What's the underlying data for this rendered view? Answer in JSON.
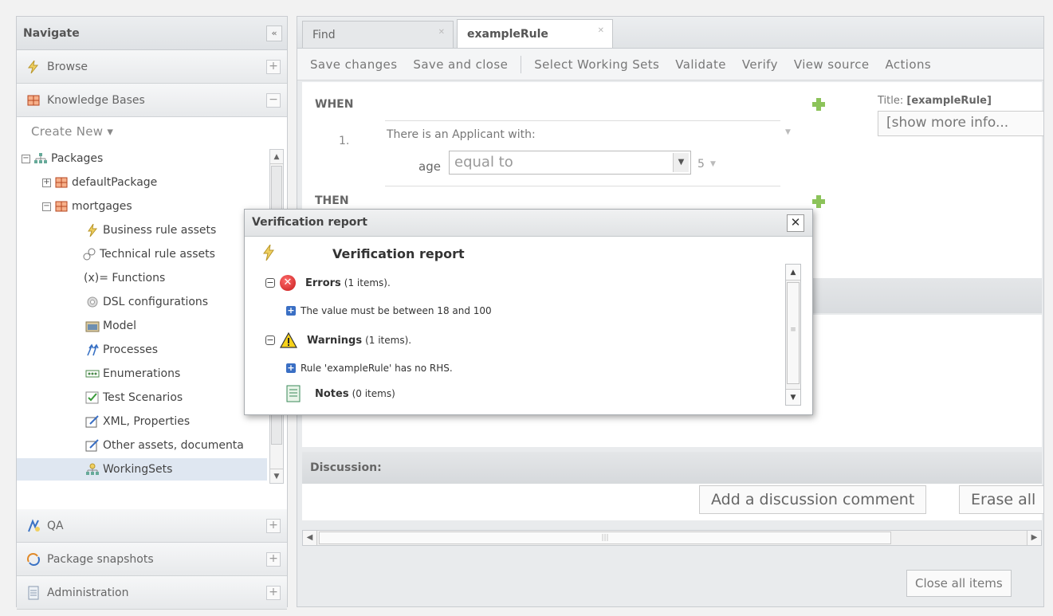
{
  "nav": {
    "title": "Navigate",
    "collapse": "«",
    "sections_top": [
      {
        "label": "Browse",
        "toggle": "+"
      },
      {
        "label": "Knowledge Bases",
        "toggle": "−"
      }
    ],
    "create_new": "Create New ▾",
    "tree": [
      {
        "label": "Packages",
        "expander": "−"
      },
      {
        "label": "defaultPackage",
        "expander": "+"
      },
      {
        "label": "mortgages",
        "expander": "−"
      },
      {
        "label": "Business rule assets"
      },
      {
        "label": "Technical rule assets"
      },
      {
        "label": "(x)= Functions"
      },
      {
        "label": "DSL configurations"
      },
      {
        "label": "Model"
      },
      {
        "label": "Processes"
      },
      {
        "label": "Enumerations"
      },
      {
        "label": "Test Scenarios"
      },
      {
        "label": "XML, Properties"
      },
      {
        "label": "Other assets, documenta"
      },
      {
        "label": "WorkingSets"
      }
    ],
    "sections_bottom": [
      {
        "label": "QA",
        "toggle": "+"
      },
      {
        "label": "Package snapshots",
        "toggle": "+"
      },
      {
        "label": "Administration",
        "toggle": "+"
      }
    ]
  },
  "tabs": [
    {
      "label": "Find",
      "close": "✕"
    },
    {
      "label": "exampleRule",
      "close": "✕"
    }
  ],
  "toolbar": {
    "save_changes": "Save changes",
    "save_close": "Save and close",
    "select_ws": "Select Working Sets",
    "validate": "Validate",
    "verify": "Verify",
    "view_source": "View source",
    "actions": "Actions"
  },
  "editor": {
    "when": "WHEN",
    "then": "THEN",
    "condition": "There is an Applicant with:",
    "number": "1.",
    "field": "age",
    "operator": "equal to",
    "value": "5",
    "title_label": "Title:",
    "title_value": "[exampleRule]",
    "more_info": "[show more info..."
  },
  "discussion": {
    "heading": "Discussion:",
    "add_comment": "Add a discussion comment",
    "erase_all": "Erase all"
  },
  "close_all": "Close all items",
  "dialog": {
    "header": "Verification report",
    "close": "✕",
    "title": "Verification report",
    "errors_label": "Errors",
    "errors_count": "(1 items).",
    "error_item": "The value must be between 18 and 100",
    "warnings_label": "Warnings",
    "warnings_count": "(1 items).",
    "warning_item": "Rule 'exampleRule' has no RHS.",
    "notes_label": "Notes",
    "notes_count": "(0 items)"
  },
  "colors": {
    "accent_green": "#8cc35a",
    "error_red": "#c61b1b",
    "warning_yellow": "#f2c200",
    "selected_row": "#dfe7f1"
  }
}
